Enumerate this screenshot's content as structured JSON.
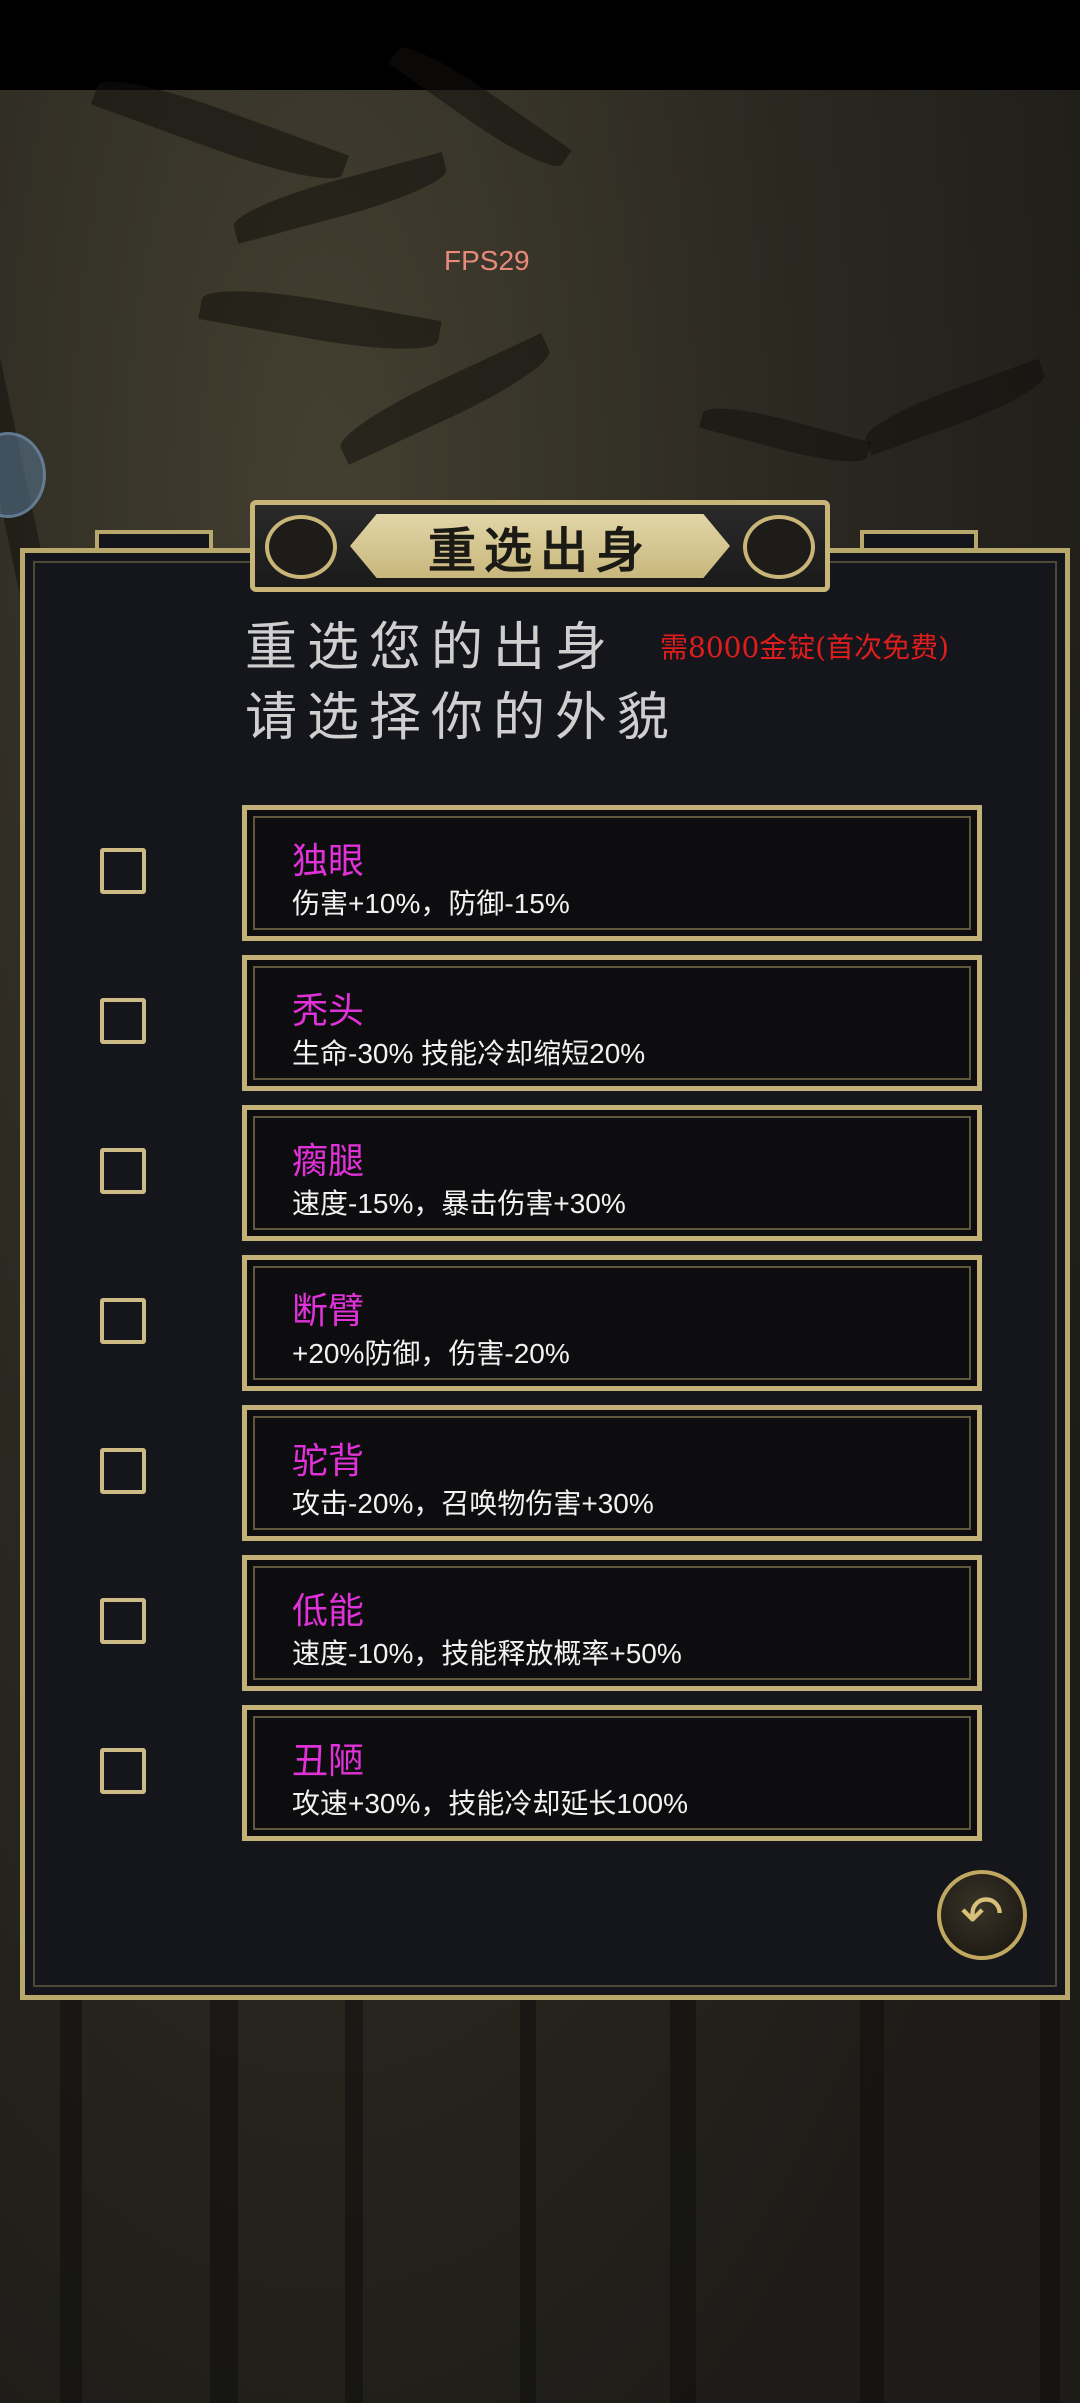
{
  "overlay": {
    "fps": "FPS29"
  },
  "panel": {
    "title": "重选出身",
    "heading_line1": "重选您的出身",
    "heading_line2": "请选择你的外貌",
    "cost_note": "需8000金锭(首次免费)"
  },
  "options": [
    {
      "name": "独眼",
      "desc": "伤害+10%，防御-15%",
      "checked": false
    },
    {
      "name": "秃头",
      "desc": "生命-30%  技能冷却缩短20%",
      "checked": false
    },
    {
      "name": "瘸腿",
      "desc": "速度-15%，暴击伤害+30%",
      "checked": false
    },
    {
      "name": "断臂",
      "desc": "+20%防御，伤害-20%",
      "checked": false
    },
    {
      "name": "驼背",
      "desc": "攻击-20%，召唤物伤害+30%",
      "checked": false
    },
    {
      "name": "低能",
      "desc": "速度-10%，技能释放概率+50%",
      "checked": false
    },
    {
      "name": "丑陋",
      "desc": "攻速+30%，技能冷却延长100%",
      "checked": false
    }
  ],
  "colors": {
    "option_title": "#e032d8",
    "cost": "#e01d1d",
    "frame_gold": "#c4b177"
  },
  "icons": {
    "back": "return-arrow-icon"
  }
}
